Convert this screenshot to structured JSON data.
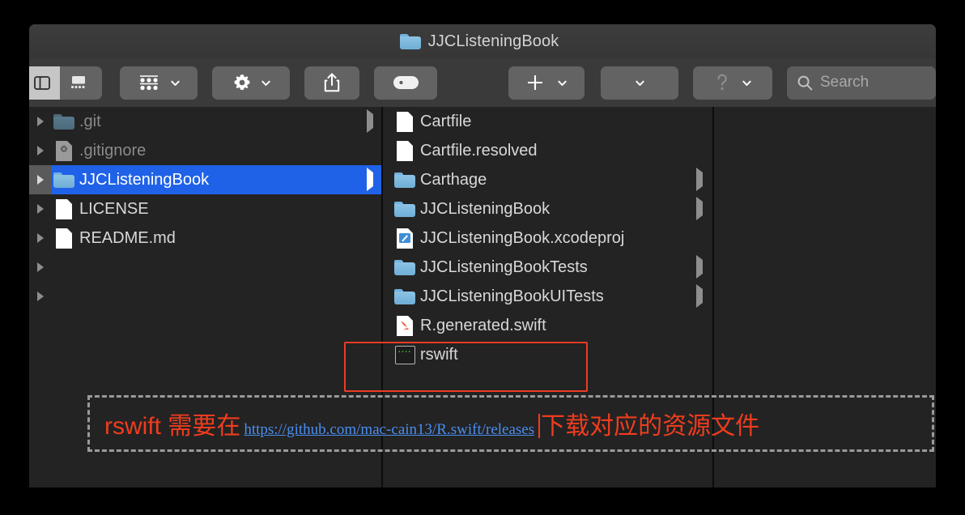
{
  "window": {
    "title": "JJCListeningBook",
    "title_icon": "folder-icon"
  },
  "toolbar": {
    "buttons": [
      {
        "name": "sidebar-toggle-button",
        "icon": "sidebar-icon"
      },
      {
        "name": "gallery-view-button",
        "icon": "gallery-view-icon"
      },
      {
        "name": "view-options-button",
        "icon": "grid-view-icon",
        "caret": "chevron-down-icon"
      },
      {
        "name": "action-menu-button",
        "icon": "gear-icon",
        "caret": "chevron-down-icon"
      },
      {
        "name": "share-button",
        "icon": "share-icon"
      },
      {
        "name": "tag-button",
        "icon": "tag-icon"
      },
      {
        "name": "add-button",
        "icon": "plus-icon",
        "caret": "chevron-down-icon"
      },
      {
        "name": "arrange-button",
        "icon": "",
        "caret": "chevron-down-icon"
      },
      {
        "name": "help-button",
        "icon": "question-icon",
        "caret": "chevron-down-icon"
      }
    ],
    "search": {
      "icon": "search-icon",
      "placeholder": "Search",
      "value": ""
    }
  },
  "columns": {
    "first": {
      "items": [
        {
          "label": ".git",
          "icon": "folder-icon-dim",
          "disclosure": true,
          "arrow": true,
          "dim": true,
          "selected": false
        },
        {
          "label": ".gitignore",
          "icon": "gitignore-file-icon",
          "disclosure": true,
          "arrow": false,
          "dim": true,
          "selected": false
        },
        {
          "label": "JJCListeningBook",
          "icon": "folder-icon",
          "disclosure": true,
          "arrow": true,
          "dim": false,
          "selected": true
        },
        {
          "label": "LICENSE",
          "icon": "document-icon",
          "disclosure": true,
          "arrow": false,
          "dim": false,
          "selected": false
        },
        {
          "label": "README.md",
          "icon": "document-icon",
          "disclosure": true,
          "arrow": false,
          "dim": false,
          "selected": false
        },
        {
          "label": "",
          "icon": "",
          "disclosure": true,
          "arrow": false,
          "dim": false,
          "selected": false
        },
        {
          "label": "",
          "icon": "",
          "disclosure": true,
          "arrow": false,
          "dim": false,
          "selected": false
        }
      ]
    },
    "second": {
      "items": [
        {
          "label": "Cartfile",
          "icon": "document-icon",
          "arrow": false
        },
        {
          "label": "Cartfile.resolved",
          "icon": "document-icon",
          "arrow": false
        },
        {
          "label": "Carthage",
          "icon": "folder-icon",
          "arrow": true
        },
        {
          "label": "JJCListeningBook",
          "icon": "folder-icon",
          "arrow": true
        },
        {
          "label": "JJCListeningBook.xcodeproj",
          "icon": "xcodeproj-icon",
          "arrow": false
        },
        {
          "label": "JJCListeningBookTests",
          "icon": "folder-icon",
          "arrow": true
        },
        {
          "label": "JJCListeningBookUITests",
          "icon": "folder-icon",
          "arrow": true
        },
        {
          "label": "R.generated.swift",
          "icon": "swift-file-icon",
          "arrow": false
        },
        {
          "label": "rswift",
          "icon": "terminal-exec-icon",
          "arrow": false,
          "highlighted": true
        }
      ]
    },
    "third": {
      "items": []
    }
  },
  "annotation": {
    "highlight_target": "rswift",
    "text_before": "rswift 需要在",
    "link": "https://github.com/mac-cain13/R.swift/releases",
    "text_after": "下载对应的资源文件",
    "colors": {
      "red": "#f03c1e",
      "link_blue": "#4a8ef0",
      "dashed_gray": "#9a9a9a",
      "selection_blue": "#1f62e8"
    }
  }
}
